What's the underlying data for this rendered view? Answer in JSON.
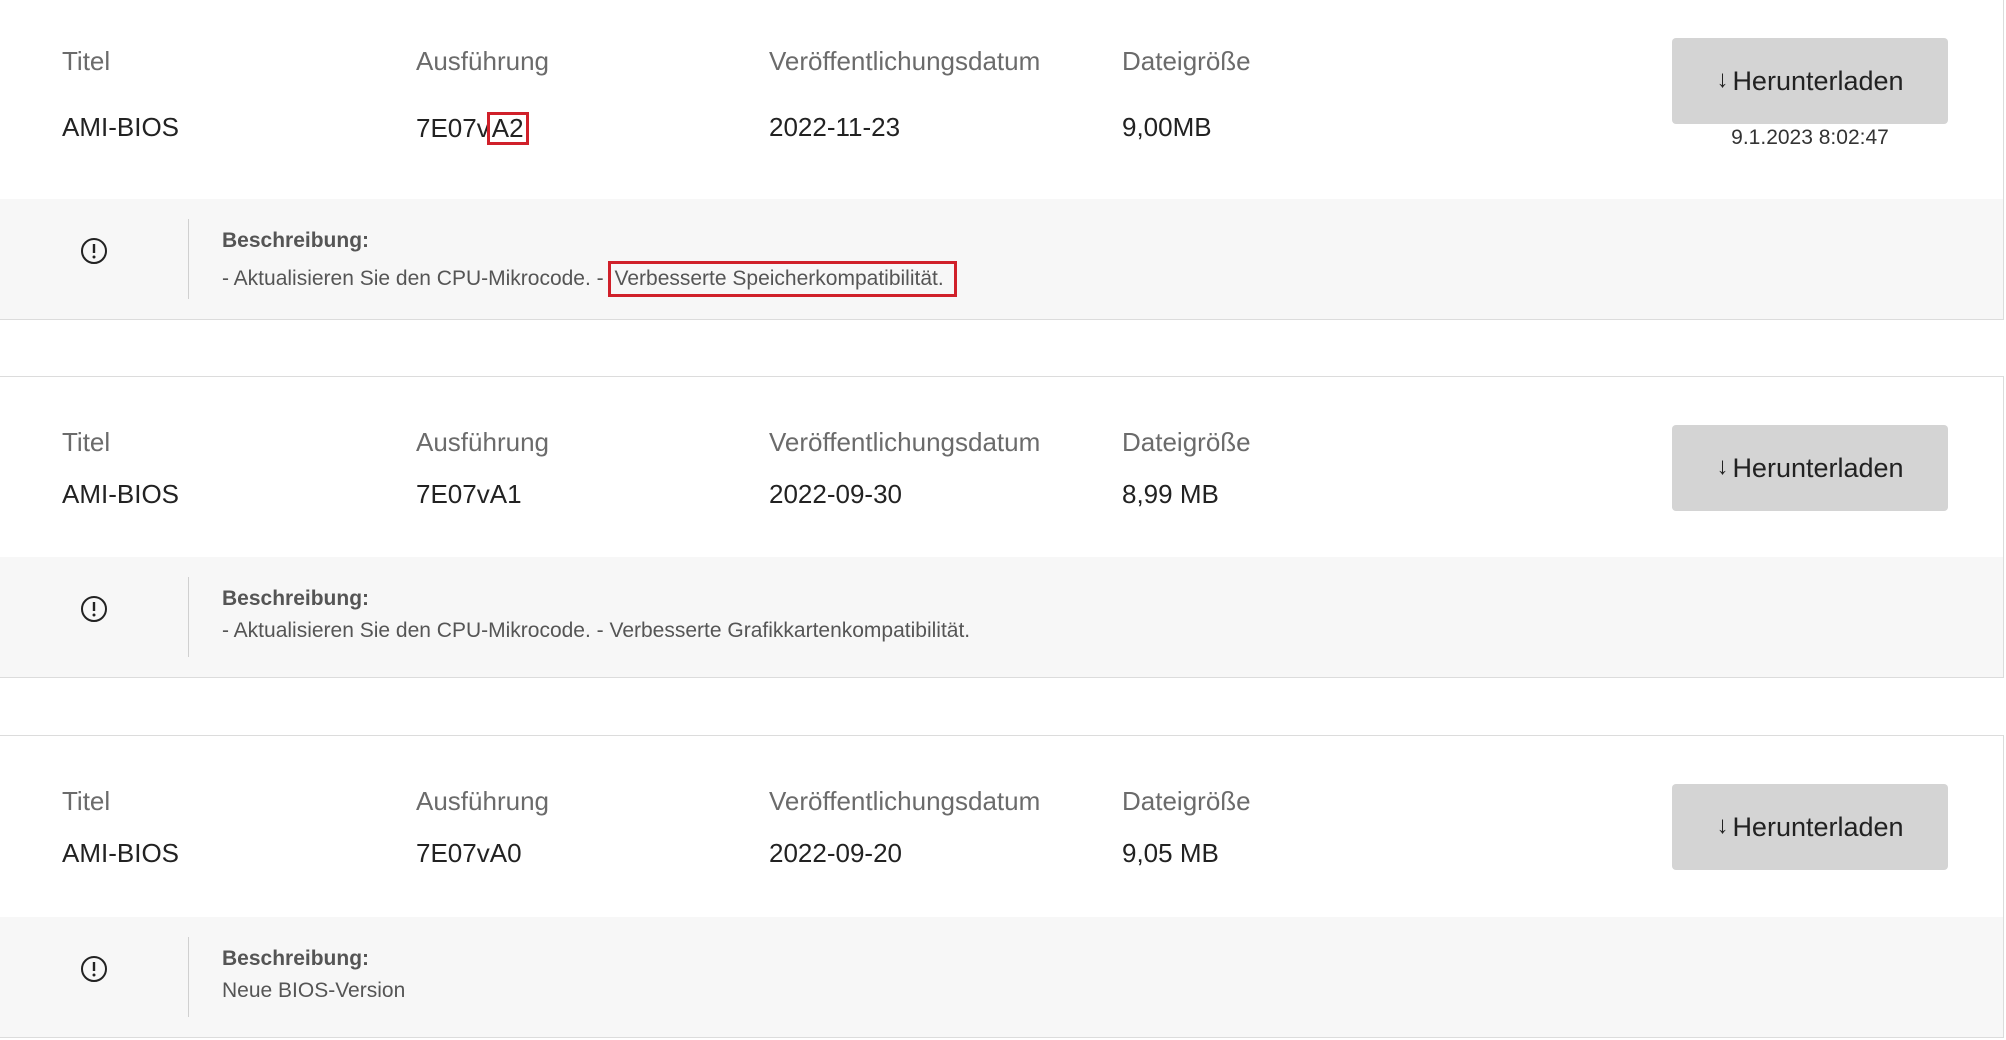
{
  "colors": {
    "button_bg": "#d4d4d4",
    "description_bg": "#f7f7f7",
    "highlight_border": "#d0202a",
    "label_text": "#6b6b6b"
  },
  "columns": {
    "title_label": "Titel",
    "version_label": "Ausführung",
    "date_label": "Veröffentlichungsdatum",
    "size_label": "Dateigröße"
  },
  "download_label": "Herunterladen",
  "download_icon": "download-arrow-icon",
  "info_icon": "exclamation-circle-icon",
  "description_label": "Beschreibung:",
  "releases": [
    {
      "title": "AMI-BIOS",
      "version_prefix": "7E07v",
      "version_highlight": "A2",
      "date": "2022-11-23",
      "size": "9,00MB",
      "timestamp": "9.1.2023 8:02:47",
      "description_prefix": "- Aktualisieren Sie den CPU-Mikrocode. -",
      "description_highlight": "Verbesserte Speicherkompatibilität."
    },
    {
      "title": "AMI-BIOS",
      "version": "7E07vA1",
      "date": "2022-09-30",
      "size": "8,99 MB",
      "description": "- Aktualisieren Sie den CPU-Mikrocode. - Verbesserte Grafikkartenkompatibilität."
    },
    {
      "title": "AMI-BIOS",
      "version": "7E07vA0",
      "date": "2022-09-20",
      "size": "9,05 MB",
      "description": "Neue BIOS-Version"
    }
  ]
}
